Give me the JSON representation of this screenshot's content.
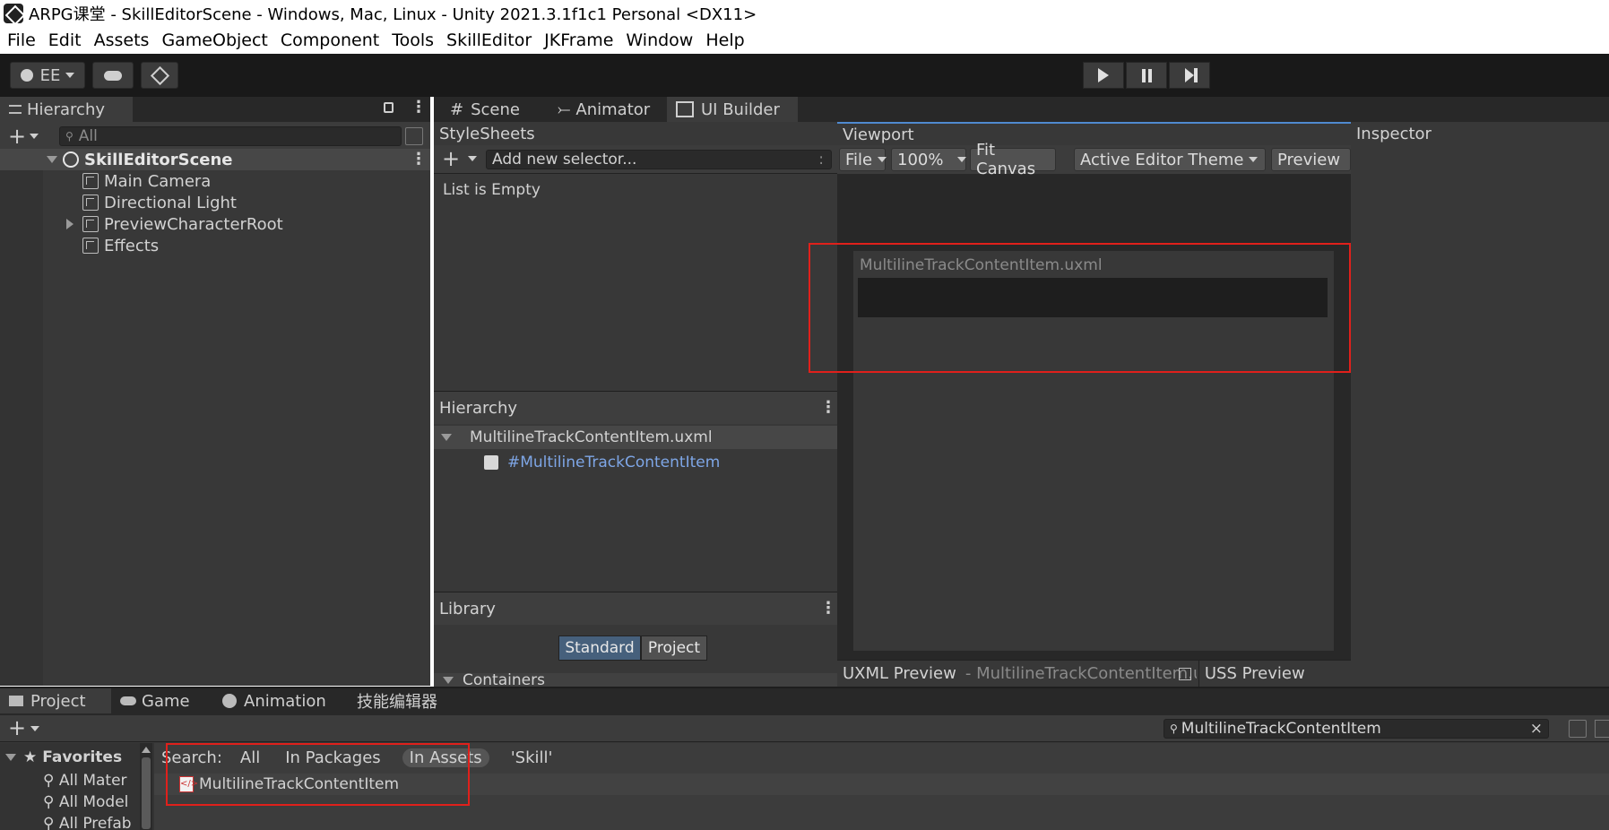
{
  "window": {
    "title": "ARPG课堂 - SkillEditorScene - Windows, Mac, Linux - Unity 2021.3.1f1c1 Personal <DX11>"
  },
  "menu": [
    "File",
    "Edit",
    "Assets",
    "GameObject",
    "Component",
    "Tools",
    "SkillEditor",
    "JKFrame",
    "Window",
    "Help"
  ],
  "toolbar": {
    "account_label": "EE",
    "play_icon": "play-icon",
    "pause_icon": "pause-icon",
    "step_icon": "step-icon"
  },
  "hierarchy": {
    "tab_label": "Hierarchy",
    "search_placeholder": "All",
    "scene_name": "SkillEditorScene",
    "items": [
      "Main Camera",
      "Directional Light",
      "PreviewCharacterRoot",
      "Effects"
    ]
  },
  "center_tabs": [
    "Scene",
    "Animator",
    "UI Builder"
  ],
  "stylesheets": {
    "title": "StyleSheets",
    "selector_placeholder": "Add new selector...",
    "empty_text": "List is Empty"
  },
  "builder_hierarchy": {
    "title": "Hierarchy",
    "root": "MultilineTrackContentItem.uxml",
    "child": "#MultilineTrackContentItem"
  },
  "library": {
    "title": "Library",
    "standard_label": "Standard",
    "project_label": "Project",
    "section": "Containers"
  },
  "viewport": {
    "title": "Viewport",
    "file_label": "File",
    "zoom": "100%",
    "fit_label": "Fit Canvas",
    "theme_label": "Active Editor Theme",
    "preview_label": "Preview",
    "canvas_title": "MultilineTrackContentItem.uxml",
    "uxml_preview_label": "UXML Preview",
    "uxml_preview_file": "- MultilineTrackContentItem.uxml",
    "uss_preview_label": "USS Preview"
  },
  "inspector": {
    "title": "Inspector"
  },
  "project_panel": {
    "tabs": [
      "Project",
      "Game",
      "Animation",
      "技能编辑器"
    ],
    "search_value": "MultilineTrackContentItem",
    "favorites_label": "Favorites",
    "favorites": [
      "All Mater",
      "All Model",
      "All Prefab"
    ],
    "search_label": "Search:",
    "search_scopes": [
      "All",
      "In Packages",
      "In Assets",
      "'Skill'"
    ],
    "result": "MultilineTrackContentItem"
  },
  "colors": {
    "highlight": "#e0201b",
    "accent_blue": "#7ea6e6",
    "selected_button": "#46607c"
  }
}
